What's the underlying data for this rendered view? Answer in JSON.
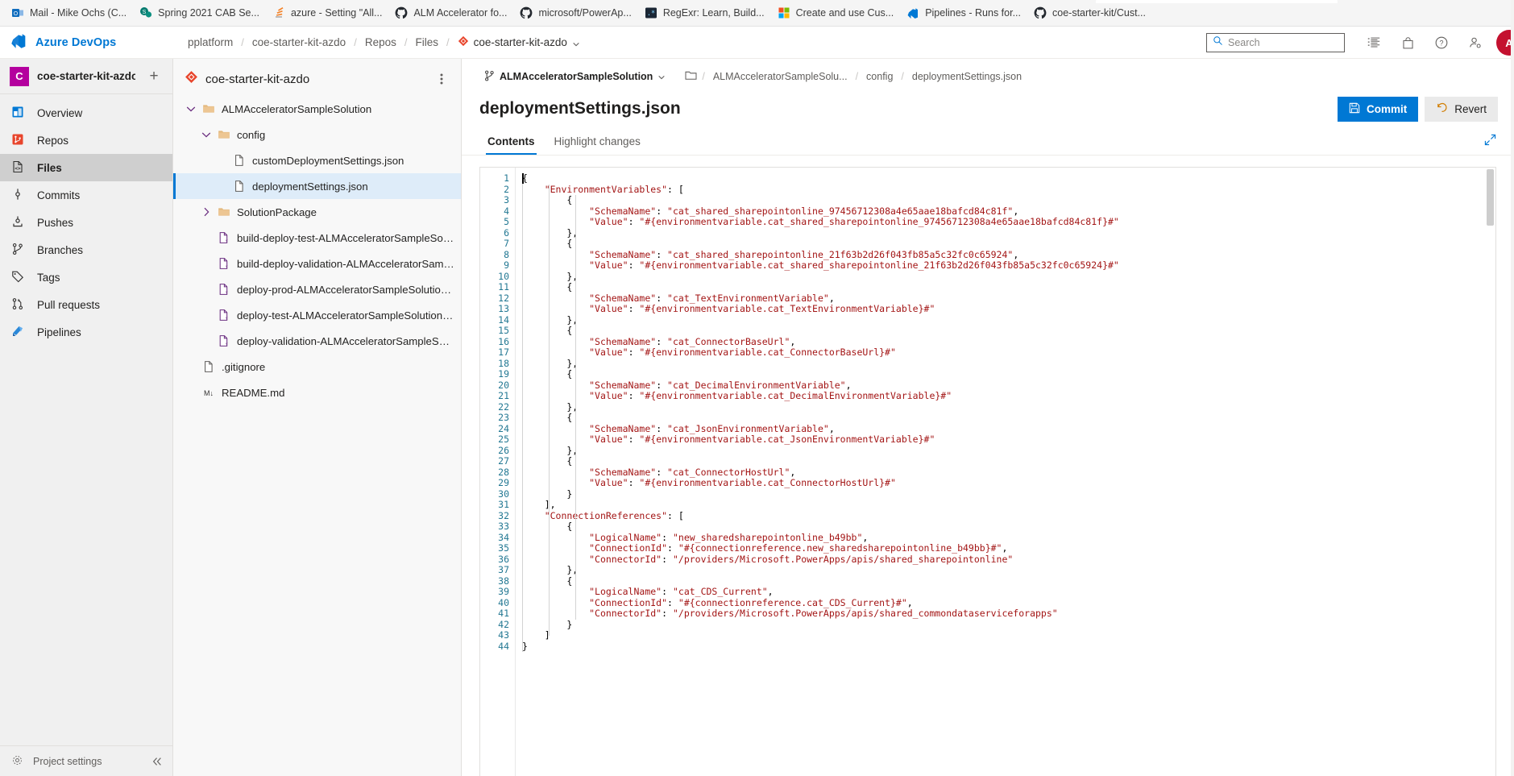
{
  "browser": {
    "bookmarks": [
      {
        "label": "Mail - Mike Ochs (C...",
        "icon": "outlook-icon"
      },
      {
        "label": "Spring 2021 CAB Se...",
        "icon": "sharepoint-icon"
      },
      {
        "label": "azure - Setting \"All...",
        "icon": "stackoverflow-icon"
      },
      {
        "label": "ALM Accelerator fo...",
        "icon": "github-icon"
      },
      {
        "label": "microsoft/PowerAp...",
        "icon": "github-icon"
      },
      {
        "label": "RegExr: Learn, Build...",
        "icon": "regexr-icon"
      },
      {
        "label": "Create and use Cus...",
        "icon": "microsoft-icon"
      },
      {
        "label": "Pipelines - Runs for...",
        "icon": "azure-devops-icon"
      },
      {
        "label": "coe-starter-kit/Cust...",
        "icon": "github-icon"
      }
    ]
  },
  "topbar": {
    "brand": "Azure DevOps",
    "brand_icon": "azure-devops-icon",
    "breadcrumbs": [
      {
        "label": "pplatform",
        "icon": null
      },
      {
        "label": "coe-starter-kit-azdo",
        "icon": null
      },
      {
        "label": "Repos",
        "icon": null
      },
      {
        "label": "Files",
        "icon": null
      },
      {
        "label": "coe-starter-kit-azdo",
        "icon": "repo-icon",
        "has_chevron": true
      }
    ],
    "search": {
      "placeholder": "Search",
      "value": "",
      "icon": "search-icon"
    },
    "actions": [
      {
        "name": "work-items-icon"
      },
      {
        "name": "marketplace-icon"
      },
      {
        "name": "help-icon"
      },
      {
        "name": "user-settings-icon"
      }
    ],
    "avatar_initial": "A",
    "avatar_color": "#c4112f"
  },
  "projectnav": {
    "project_initial": "C",
    "project_name": "coe-starter-kit-azdo",
    "add_label": "+",
    "items": [
      {
        "label": "Overview",
        "icon": "overview-icon",
        "selected": false
      },
      {
        "label": "Repos",
        "icon": "repos-icon",
        "selected": false
      },
      {
        "label": "Files",
        "icon": "files-icon",
        "selected": true
      },
      {
        "label": "Commits",
        "icon": "commits-icon",
        "selected": false
      },
      {
        "label": "Pushes",
        "icon": "pushes-icon",
        "selected": false
      },
      {
        "label": "Branches",
        "icon": "branches-icon",
        "selected": false
      },
      {
        "label": "Tags",
        "icon": "tags-icon",
        "selected": false
      },
      {
        "label": "Pull requests",
        "icon": "pull-requests-icon",
        "selected": false
      },
      {
        "label": "Pipelines",
        "icon": "pipelines-icon",
        "selected": false
      }
    ],
    "footer": {
      "label": "Project settings",
      "icon": "settings-icon"
    }
  },
  "filetree": {
    "title": "coe-starter-kit-azdo",
    "title_icon": "repo-icon",
    "more_icon": "more-vertical-icon",
    "rows": [
      {
        "label": "ALMAcceleratorSampleSolution",
        "type": "folder",
        "indent": 0,
        "chevron": "down",
        "selected": false
      },
      {
        "label": "config",
        "type": "folder",
        "indent": 1,
        "chevron": "down",
        "selected": false
      },
      {
        "label": "customDeploymentSettings.json",
        "type": "file",
        "indent": 2,
        "chevron": "none",
        "selected": false
      },
      {
        "label": "deploymentSettings.json",
        "type": "file",
        "indent": 2,
        "chevron": "none",
        "selected": true
      },
      {
        "label": "SolutionPackage",
        "type": "folder",
        "indent": 1,
        "chevron": "right",
        "selected": false
      },
      {
        "label": "build-deploy-test-ALMAcceleratorSampleSolutio...",
        "type": "yaml",
        "indent": 1,
        "chevron": "none",
        "selected": false
      },
      {
        "label": "build-deploy-validation-ALMAcceleratorSampleS...",
        "type": "yaml",
        "indent": 1,
        "chevron": "none",
        "selected": false
      },
      {
        "label": "deploy-prod-ALMAcceleratorSampleSolution.yml",
        "type": "yaml",
        "indent": 1,
        "chevron": "none",
        "selected": false
      },
      {
        "label": "deploy-test-ALMAcceleratorSampleSolution.yml",
        "type": "yaml",
        "indent": 1,
        "chevron": "none",
        "selected": false
      },
      {
        "label": "deploy-validation-ALMAcceleratorSampleSolutio...",
        "type": "yaml",
        "indent": 1,
        "chevron": "none",
        "selected": false
      },
      {
        "label": ".gitignore",
        "type": "file",
        "indent": 0,
        "chevron": "none",
        "selected": false
      },
      {
        "label": "README.md",
        "type": "markdown",
        "indent": 0,
        "chevron": "none",
        "selected": false
      }
    ]
  },
  "filepane": {
    "branch": "ALMAcceleratorSampleSolution",
    "branch_icon": "branch-icon",
    "folder_icon": "folder-outline-icon",
    "path_crumbs": [
      "ALMAcceleratorSampleSolu...",
      "config",
      "deploymentSettings.json"
    ],
    "file_title": "deploymentSettings.json",
    "commit_label": "Commit",
    "commit_icon": "save-icon",
    "revert_label": "Revert",
    "revert_icon": "undo-icon",
    "expand_icon": "expand-icon",
    "tabs": [
      {
        "label": "Contents",
        "active": true
      },
      {
        "label": "Highlight changes",
        "active": false
      }
    ]
  },
  "code": {
    "language": "json",
    "total_lines": 44,
    "lines": [
      "{",
      "    \"EnvironmentVariables\": [",
      "        {",
      "            \"SchemaName\": \"cat_shared_sharepointonline_97456712308a4e65aae18bafcd84c81f\",",
      "            \"Value\": \"#{environmentvariable.cat_shared_sharepointonline_97456712308a4e65aae18bafcd84c81f}#\"",
      "        },",
      "        {",
      "            \"SchemaName\": \"cat_shared_sharepointonline_21f63b2d26f043fb85a5c32fc0c65924\",",
      "            \"Value\": \"#{environmentvariable.cat_shared_sharepointonline_21f63b2d26f043fb85a5c32fc0c65924}#\"",
      "        },",
      "        {",
      "            \"SchemaName\": \"cat_TextEnvironmentVariable\",",
      "            \"Value\": \"#{environmentvariable.cat_TextEnvironmentVariable}#\"",
      "        },",
      "        {",
      "            \"SchemaName\": \"cat_ConnectorBaseUrl\",",
      "            \"Value\": \"#{environmentvariable.cat_ConnectorBaseUrl}#\"",
      "        },",
      "        {",
      "            \"SchemaName\": \"cat_DecimalEnvironmentVariable\",",
      "            \"Value\": \"#{environmentvariable.cat_DecimalEnvironmentVariable}#\"",
      "        },",
      "        {",
      "            \"SchemaName\": \"cat_JsonEnvironmentVariable\",",
      "            \"Value\": \"#{environmentvariable.cat_JsonEnvironmentVariable}#\"",
      "        },",
      "        {",
      "            \"SchemaName\": \"cat_ConnectorHostUrl\",",
      "            \"Value\": \"#{environmentvariable.cat_ConnectorHostUrl}#\"",
      "        }",
      "    ],",
      "    \"ConnectionReferences\": [",
      "        {",
      "            \"LogicalName\": \"new_sharedsharepointonline_b49bb\",",
      "            \"ConnectionId\": \"#{connectionreference.new_sharedsharepointonline_b49bb}#\",",
      "            \"ConnectorId\": \"/providers/Microsoft.PowerApps/apis/shared_sharepointonline\"",
      "        },",
      "        {",
      "            \"LogicalName\": \"cat_CDS_Current\",",
      "            \"ConnectionId\": \"#{connectionreference.cat_CDS_Current}#\",",
      "            \"ConnectorId\": \"/providers/Microsoft.PowerApps/apis/shared_commondataserviceforapps\"",
      "        }",
      "    ]",
      "}"
    ]
  },
  "colors": {
    "accent": "#0078d4",
    "project_tile": "#b4009e",
    "repo_red": "#e8452c",
    "selection": "#deecf9",
    "json_string": "#a31515",
    "gutter_number": "#237893"
  }
}
